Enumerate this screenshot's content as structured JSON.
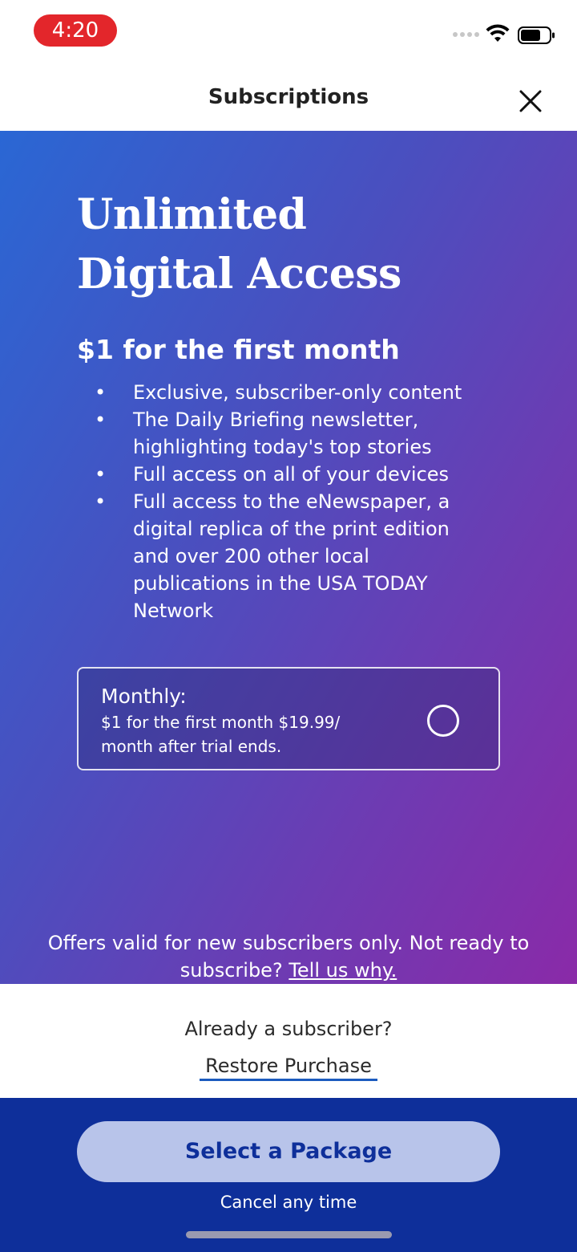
{
  "status_bar": {
    "time": "4:20",
    "icons": [
      "signal-dots-icon",
      "wifi-icon",
      "battery-icon"
    ]
  },
  "header": {
    "title": "Subscriptions",
    "close_icon": "close-icon"
  },
  "hero": {
    "title_line1": "Unlimited",
    "title_line2": "Digital Access",
    "offer_heading": "$1 for the first month",
    "benefits": [
      {
        "bullet": "•",
        "lines": [
          "Exclusive, subscriber-only content"
        ]
      },
      {
        "bullet": "•",
        "lines": [
          "The Daily Briefing newsletter,",
          "highlighting today's top stories"
        ]
      },
      {
        "bullet": "•",
        "lines": [
          "Full access on all of your devices"
        ]
      },
      {
        "bullet": "•",
        "lines": [
          "Full access to the eNewspaper, a",
          "digital replica of the print edition",
          "and over 200 other local",
          "publications in the USA TODAY",
          "Network"
        ]
      }
    ],
    "plan": {
      "name": "Monthly:",
      "desc_line1": "$1 for the first month $19.99/",
      "desc_line2": "month after trial ends.",
      "selected": false
    },
    "disclaimer_line1": "Offers valid for new subscribers only. Not ready to",
    "disclaimer_prefix": "subscribe? ",
    "disclaimer_link": "Tell us why."
  },
  "restore": {
    "question": "Already a subscriber?",
    "link": "Restore Purchase"
  },
  "footer": {
    "button_label": "Select a Package",
    "note": "Cancel any time"
  },
  "colors": {
    "time_pill": "#e3262b",
    "gradient_start": "#2a67d4",
    "gradient_end": "#8a2aa8",
    "footer_bg": "#0e2f9a",
    "button_bg": "#b8c4ea",
    "link_underline": "#1c5bbf"
  }
}
